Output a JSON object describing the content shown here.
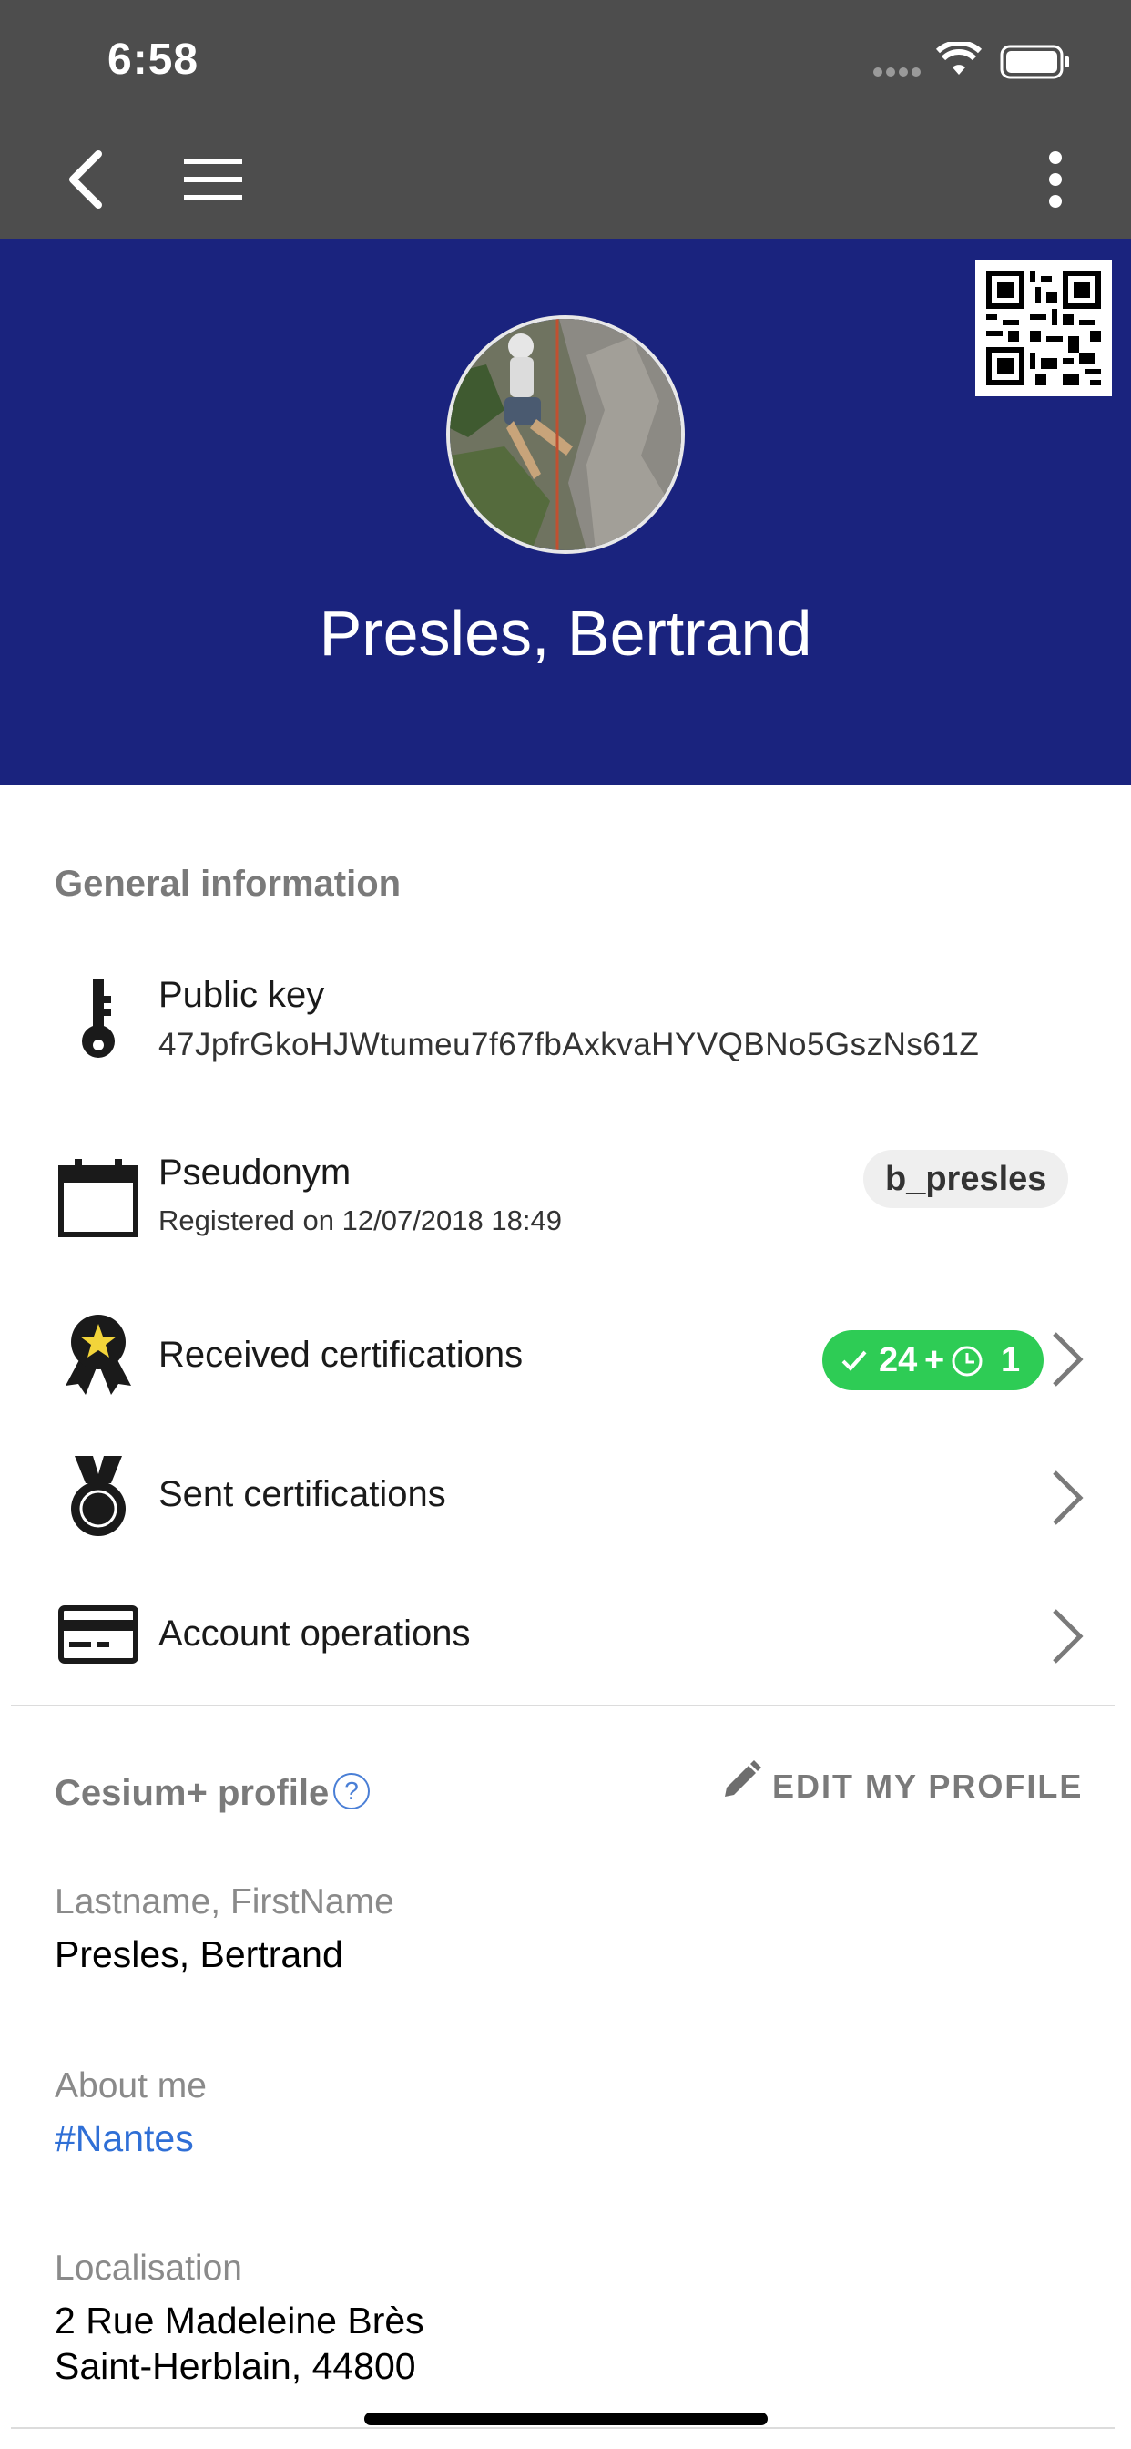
{
  "status_bar": {
    "time": "6:58"
  },
  "header": {
    "name": "Presles, Bertrand"
  },
  "general": {
    "section_title": "General information",
    "public_key": {
      "label": "Public key",
      "value": "47JpfrGkoHJWtumeu7f67fbAxkvaHYVQBNo5GszNs61Z"
    },
    "pseudonym": {
      "label": "Pseudonym",
      "registered": "Registered on 12/07/2018 18:49",
      "value": "b_presles"
    },
    "received_certifications": {
      "label": "Received certifications",
      "count": "24",
      "pending_prefix": "+",
      "pending_count": "1"
    },
    "sent_certifications": {
      "label": "Sent certifications"
    },
    "account_operations": {
      "label": "Account operations"
    }
  },
  "profile": {
    "section_title": "Cesium+ profile",
    "help": "?",
    "edit_label": "EDIT MY PROFILE",
    "name_label": "Lastname, FirstName",
    "name_value": "Presles, Bertrand",
    "about_label": "About me",
    "about_value": "#Nantes",
    "location_label": "Localisation",
    "location_line1": "2 Rue Madeleine Brès",
    "location_line2": "Saint-Herblain, 44800"
  },
  "colors": {
    "header_bg": "#1a237e",
    "topbar_bg": "#4d4d4d",
    "badge_green": "#2ecc55",
    "link_blue": "#2f6fd6"
  },
  "icons": [
    "back-icon",
    "menu-icon",
    "more-vertical-icon",
    "qr-code-icon",
    "key-icon",
    "calendar-icon",
    "award-star-icon",
    "medal-icon",
    "credit-card-icon",
    "help-circle-icon",
    "pencil-icon",
    "chevron-right-icon"
  ]
}
